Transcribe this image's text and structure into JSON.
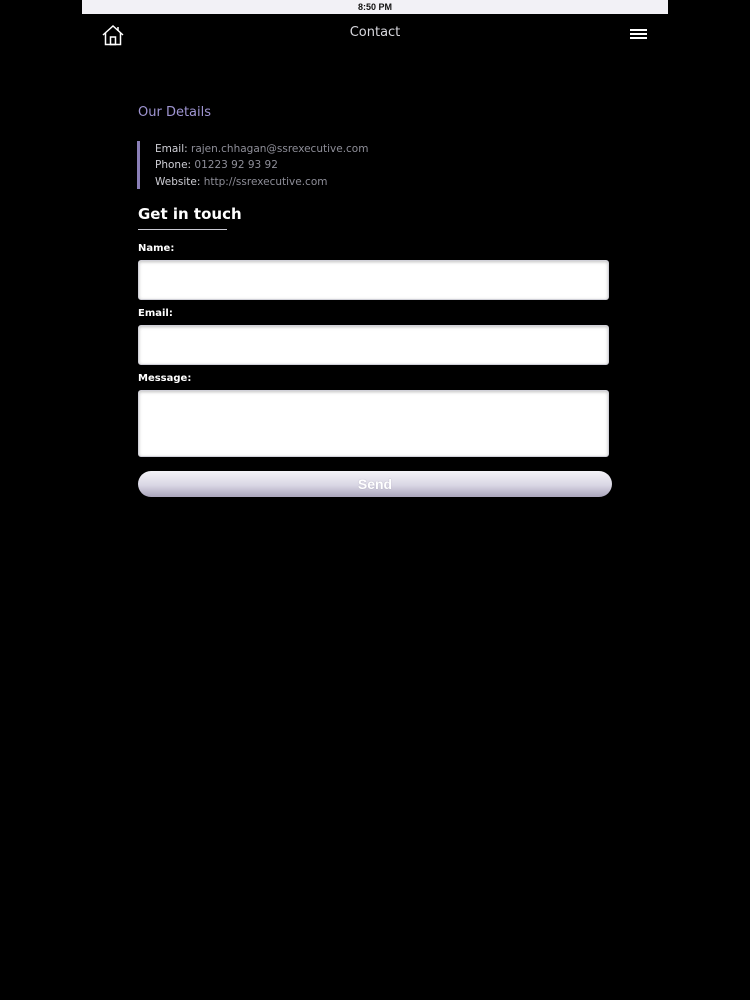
{
  "status_bar": {
    "time": "8:50 PM"
  },
  "nav": {
    "title": "Contact",
    "home_icon": "home-icon",
    "menu_icon": "hamburger-menu-icon"
  },
  "details": {
    "heading": "Our Details",
    "email_label": "Email:",
    "email_value": "rajen.chhagan@ssrexecutive.com",
    "phone_label": "Phone:",
    "phone_value": "01223 92 93 92",
    "website_label": "Website:",
    "website_value": "http://ssrexecutive.com"
  },
  "form": {
    "heading": "Get in touch",
    "name_label": "Name:",
    "name_value": "",
    "email_label": "Email:",
    "email_value": "",
    "message_label": "Message:",
    "message_value": "",
    "send_label": "Send"
  },
  "colors": {
    "background": "#000000",
    "accent": "#9f95d2",
    "accent_bar": "#8a7fb8"
  }
}
